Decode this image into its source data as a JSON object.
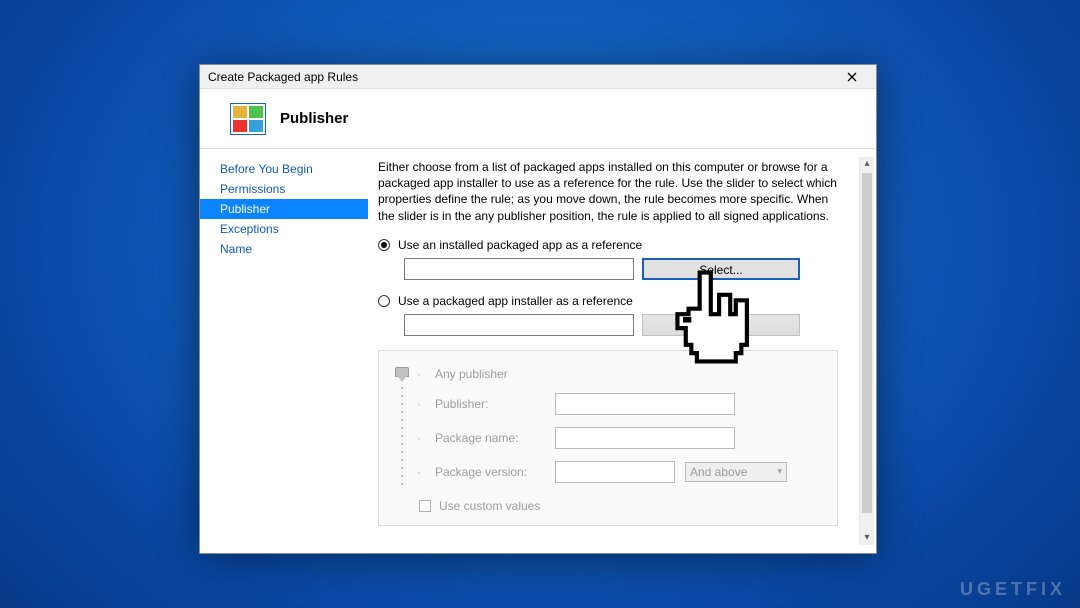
{
  "window": {
    "title": "Create Packaged app Rules"
  },
  "header": {
    "page_title": "Publisher"
  },
  "nav": {
    "items": [
      {
        "label": "Before You Begin"
      },
      {
        "label": "Permissions"
      },
      {
        "label": "Publisher"
      },
      {
        "label": "Exceptions"
      },
      {
        "label": "Name"
      }
    ],
    "active_index": 2
  },
  "content": {
    "description": "Either choose from a list of packaged apps installed on this computer or browse for a packaged app installer to use as a reference for the rule. Use the slider to select which properties define the rule; as you move down, the rule becomes more specific. When the slider is in the any publisher position, the rule is applied to all signed applications.",
    "option1_label": "Use an installed packaged app as a reference",
    "option1_button": "Select...",
    "option2_label": "Use a packaged app installer as a reference",
    "option2_button": "Browse...",
    "props": {
      "any_publisher": "Any publisher",
      "publisher": "Publisher:",
      "package_name": "Package name:",
      "package_version": "Package version:",
      "version_mode": "And above"
    },
    "use_custom_values": "Use custom values"
  },
  "watermark": "UGETFIX"
}
